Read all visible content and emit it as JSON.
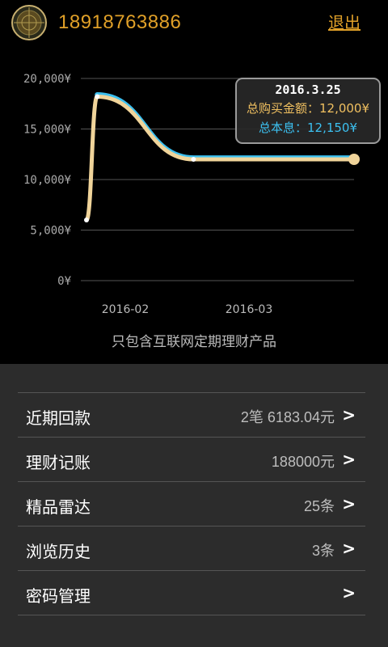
{
  "header": {
    "phone": "18918763886",
    "logout_label": "退出"
  },
  "colors": {
    "accent": "#e0a028",
    "total_interest_line": "#3cc0f0",
    "total_purchase_line": "#f0d49a"
  },
  "icons": {
    "avatar": "radar-icon",
    "chevron": "chevron-right-icon"
  },
  "chart_data": {
    "type": "line",
    "y_tick_labels": [
      "20,000¥",
      "15,000¥",
      "10,000¥",
      "5,000¥",
      "0¥"
    ],
    "y_ticks": [
      20000,
      15000,
      10000,
      5000,
      0
    ],
    "ylim": [
      0,
      20000
    ],
    "x_tick_labels": [
      "2016-02",
      "2016-03"
    ],
    "grid": true,
    "series": [
      {
        "name": "总购买金额",
        "points": [
          [
            0.0,
            6000
          ],
          [
            0.04,
            18200
          ],
          [
            0.4,
            12000
          ],
          [
            1.0,
            12000
          ]
        ]
      },
      {
        "name": "总本息",
        "points": [
          [
            0.04,
            18400
          ],
          [
            0.4,
            12150
          ],
          [
            1.0,
            12150
          ]
        ]
      }
    ],
    "note": "只包含互联网定期理财产品",
    "tooltip": {
      "date": "2016.3.25",
      "buy_label": "总购买金额：",
      "buy_value": "12,000¥",
      "interest_label": "总本息：",
      "interest_value": "12,150¥"
    }
  },
  "menu": [
    {
      "label": "近期回款",
      "value": "2笔 6183.04元",
      "chevron": ">"
    },
    {
      "label": "理财记账",
      "value": "188000元",
      "chevron": ">"
    },
    {
      "label": "精品雷达",
      "value": "25条",
      "chevron": ">"
    },
    {
      "label": "浏览历史",
      "value": "3条",
      "chevron": ">"
    },
    {
      "label": "密码管理",
      "value": "",
      "chevron": ">"
    }
  ]
}
